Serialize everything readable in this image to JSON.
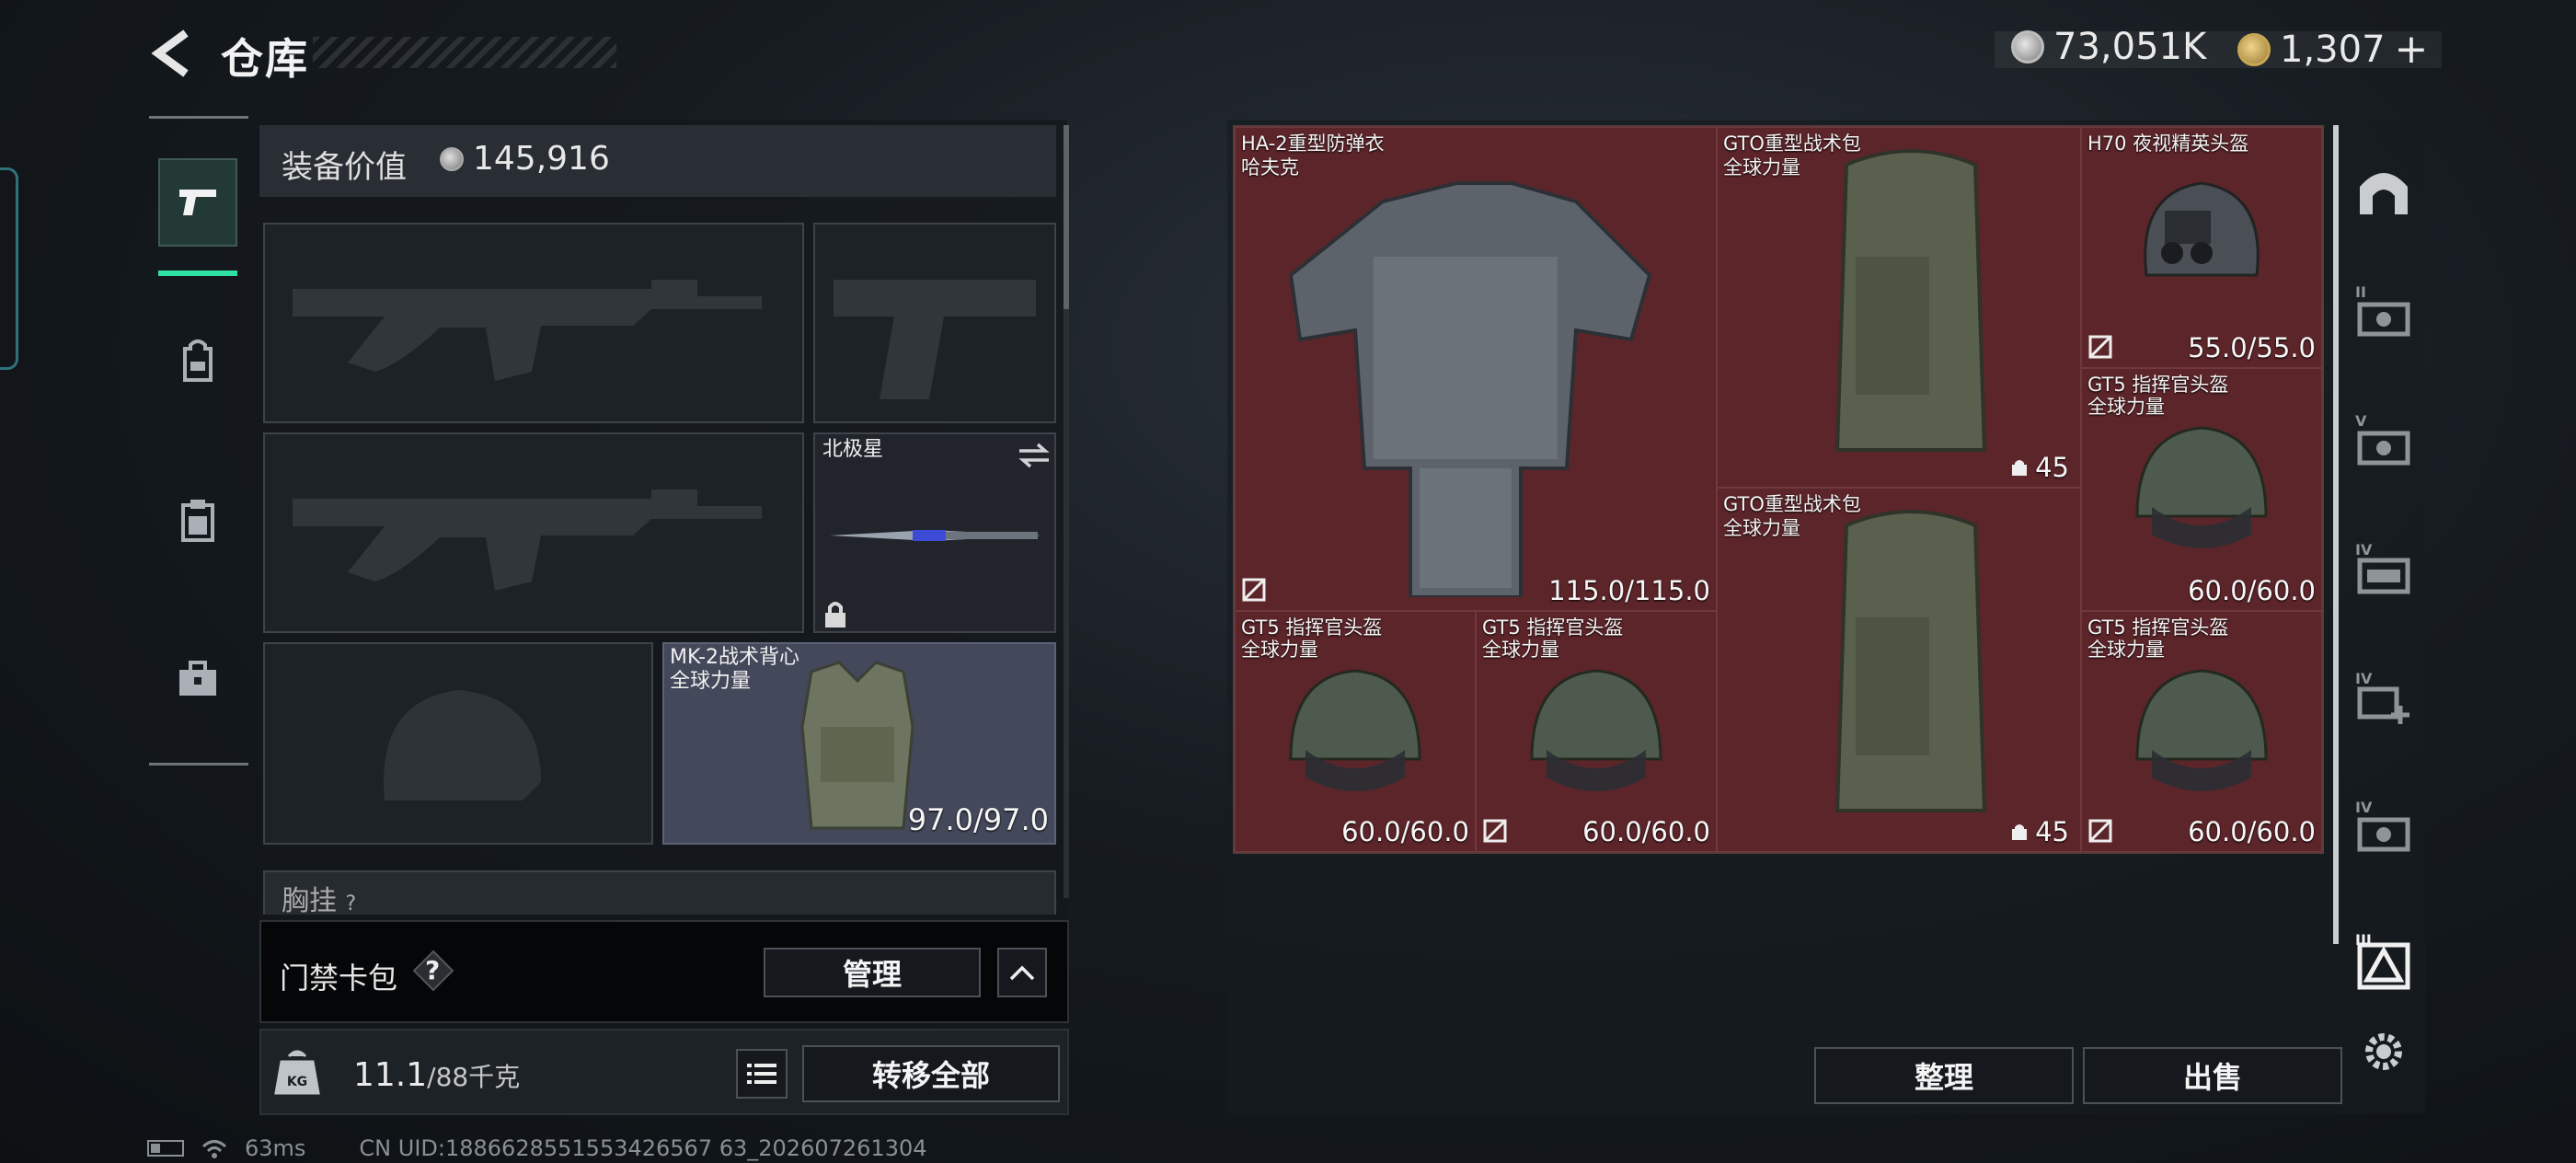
{
  "header": {
    "title": "仓库",
    "currency_silver": "73,051K",
    "currency_gold": "1,307",
    "currency_gold_add": "+"
  },
  "rail": {
    "items": [
      {
        "icon": "pistol-icon",
        "active": true
      },
      {
        "icon": "backpack-icon",
        "active": false
      },
      {
        "icon": "clipboard-icon",
        "active": false
      },
      {
        "icon": "briefcase-icon",
        "active": false
      }
    ],
    "accent_color": "#2fe0a3"
  },
  "equipment": {
    "value_label": "装备价值",
    "value_amount": "145,916",
    "melee_label": "北极星",
    "vest_name": "MK-2战术背心",
    "vest_owner": "全球力量",
    "vest_durability": "97.0/97.0",
    "chest_label": "胸挂",
    "chest_hint": "?"
  },
  "keycard": {
    "label": "门禁卡包",
    "help": "?",
    "manage_label": "管理"
  },
  "bottom": {
    "weight_current": "11.1",
    "weight_max": "/88千克",
    "transfer_label": "转移全部"
  },
  "stash": {
    "items": [
      {
        "name": "HA-2重型防弹衣",
        "sub": "哈夫克",
        "durability": "115.0/115.0"
      },
      {
        "name": "GTO重型战术包",
        "sub": "全球力量",
        "capacity": "45"
      },
      {
        "name": "H70 夜视精英头盔",
        "sub": "",
        "durability": "55.0/55.0"
      },
      {
        "name": "GT5 指挥官头盔",
        "sub": "全球力量",
        "durability": "60.0/60.0"
      },
      {
        "name": "GTO重型战术包",
        "sub": "全球力量",
        "capacity": "45"
      },
      {
        "name": "GT5 指挥官头盔",
        "sub": "全球力量",
        "durability": "60.0/60.0"
      },
      {
        "name": "GT5 指挥官头盔",
        "sub": "全球力量",
        "durability": "60.0/60.0"
      },
      {
        "name": "GT5 指挥官头盔",
        "sub": "全球力量",
        "durability": "60.0/60.0"
      }
    ],
    "cell_color": "#5c252a",
    "sort_label": "整理",
    "sell_label": "出售"
  },
  "right_rail": {
    "icons": [
      "exit-arch-icon",
      "stash-ii-icon",
      "stash-v-icon",
      "stash-iv-icon",
      "stash-iv-add-icon",
      "stash-iv-b-icon",
      "stash-iii-active-icon",
      "settings-gear-icon"
    ],
    "labels": [
      "",
      "II",
      "V",
      "IV",
      "IV",
      "IV",
      "III",
      ""
    ]
  },
  "status": {
    "ping": "63ms",
    "uid": "CN UID:1886628551553426567 63_202607261304"
  }
}
